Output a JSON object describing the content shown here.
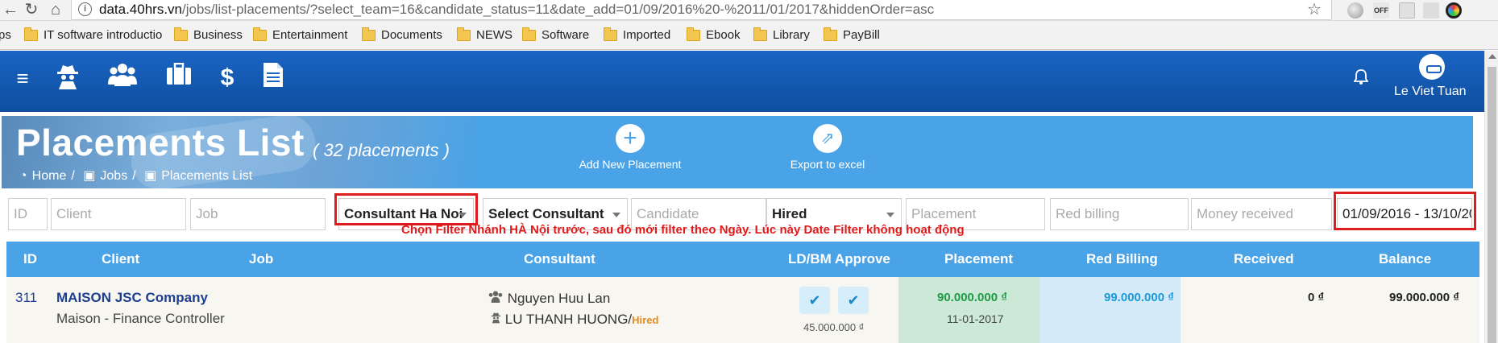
{
  "browser": {
    "url_host": "data.40hrs.vn",
    "url_path": "/jobs/list-placements/?select_team=16&candidate_status=11&date_add=01/09/2016%20-%2011/01/2017&hiddenOrder=asc",
    "ext_off_label": "OFF",
    "bookmarks": [
      "ps",
      "IT software introductio",
      "Business",
      "Entertainment",
      "Documents",
      "NEWS",
      "Software",
      "Imported",
      "Ebook",
      "Library",
      "PayBill"
    ]
  },
  "appbar": {
    "icons": [
      "menu-icon",
      "spy-icon",
      "users-icon",
      "briefcase-icon",
      "dollar-icon",
      "document-icon",
      "bell-icon"
    ],
    "username": "Le Viet Tuan"
  },
  "hero": {
    "title": "Placements List",
    "count": "( 32 placements )",
    "breadcrumb": [
      "Home",
      "/",
      "Jobs",
      "/",
      "Placements List"
    ],
    "add_label": "Add New Placement",
    "export_label": "Export to excel"
  },
  "filters": {
    "id_placeholder": "ID",
    "client_placeholder": "Client",
    "job_placeholder": "Job",
    "branch_value": "Consultant Ha Noi",
    "consultant_value": "Select Consultant",
    "candidate_placeholder": "Candidate",
    "status_value": "Hired",
    "placement_placeholder": "Placement",
    "red_billing_placeholder": "Red billing",
    "money_received_placeholder": "Money received",
    "date_range": "01/09/2016 - 13/10/20"
  },
  "annotation": {
    "note": "Chọn Filter Nhánh HÀ Nội trước, sau đó mới filter theo Ngày. Lúc này Date Filter không hoạt động",
    "color": "#e01b1b"
  },
  "table": {
    "headers": [
      "ID",
      "Client",
      "Job",
      "Consultant",
      "LD/BM Approve",
      "Placement",
      "Red Billing",
      "Received",
      "Balance"
    ],
    "rows": [
      {
        "id": "311",
        "client": "MAISON JSC Company",
        "job": "Maison - Finance Controller",
        "consultant": "Nguyen Huu Lan",
        "candidate": "LU THANH HUONG/",
        "candidate_status": "Hired",
        "approve_amount": "45.000.000 ₫",
        "placement": "90.000.000 ₫",
        "placement_date": "11-01-2017",
        "red_billing": "99.000.000 ₫",
        "received": "0 ₫",
        "balance": "99.000.000 ₫"
      }
    ]
  },
  "colors": {
    "appbar": "#1a64c3",
    "hero": "#4aa3e6",
    "placement_green": "#1f9a45",
    "red_billing_blue": "#1a9ad8",
    "hired_orange": "#e68a1f",
    "client_link": "#1d3f8f"
  }
}
